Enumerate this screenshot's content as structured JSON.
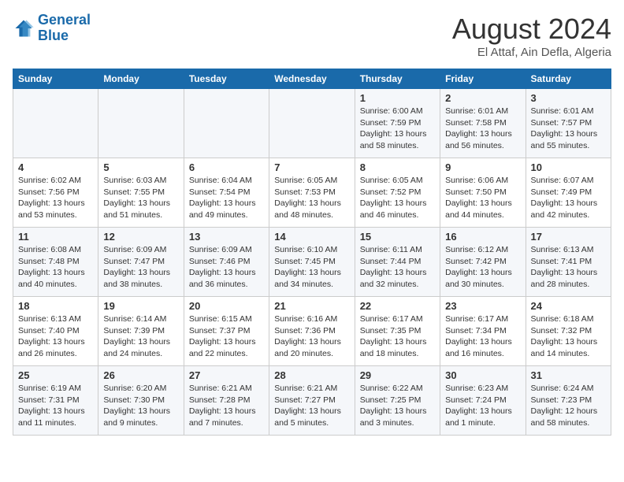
{
  "header": {
    "logo_line1": "General",
    "logo_line2": "Blue",
    "month": "August 2024",
    "location": "El Attaf, Ain Defla, Algeria"
  },
  "columns": [
    "Sunday",
    "Monday",
    "Tuesday",
    "Wednesday",
    "Thursday",
    "Friday",
    "Saturday"
  ],
  "weeks": [
    [
      {
        "day": "",
        "info": ""
      },
      {
        "day": "",
        "info": ""
      },
      {
        "day": "",
        "info": ""
      },
      {
        "day": "",
        "info": ""
      },
      {
        "day": "1",
        "info": "Sunrise: 6:00 AM\nSunset: 7:59 PM\nDaylight: 13 hours\nand 58 minutes."
      },
      {
        "day": "2",
        "info": "Sunrise: 6:01 AM\nSunset: 7:58 PM\nDaylight: 13 hours\nand 56 minutes."
      },
      {
        "day": "3",
        "info": "Sunrise: 6:01 AM\nSunset: 7:57 PM\nDaylight: 13 hours\nand 55 minutes."
      }
    ],
    [
      {
        "day": "4",
        "info": "Sunrise: 6:02 AM\nSunset: 7:56 PM\nDaylight: 13 hours\nand 53 minutes."
      },
      {
        "day": "5",
        "info": "Sunrise: 6:03 AM\nSunset: 7:55 PM\nDaylight: 13 hours\nand 51 minutes."
      },
      {
        "day": "6",
        "info": "Sunrise: 6:04 AM\nSunset: 7:54 PM\nDaylight: 13 hours\nand 49 minutes."
      },
      {
        "day": "7",
        "info": "Sunrise: 6:05 AM\nSunset: 7:53 PM\nDaylight: 13 hours\nand 48 minutes."
      },
      {
        "day": "8",
        "info": "Sunrise: 6:05 AM\nSunset: 7:52 PM\nDaylight: 13 hours\nand 46 minutes."
      },
      {
        "day": "9",
        "info": "Sunrise: 6:06 AM\nSunset: 7:50 PM\nDaylight: 13 hours\nand 44 minutes."
      },
      {
        "day": "10",
        "info": "Sunrise: 6:07 AM\nSunset: 7:49 PM\nDaylight: 13 hours\nand 42 minutes."
      }
    ],
    [
      {
        "day": "11",
        "info": "Sunrise: 6:08 AM\nSunset: 7:48 PM\nDaylight: 13 hours\nand 40 minutes."
      },
      {
        "day": "12",
        "info": "Sunrise: 6:09 AM\nSunset: 7:47 PM\nDaylight: 13 hours\nand 38 minutes."
      },
      {
        "day": "13",
        "info": "Sunrise: 6:09 AM\nSunset: 7:46 PM\nDaylight: 13 hours\nand 36 minutes."
      },
      {
        "day": "14",
        "info": "Sunrise: 6:10 AM\nSunset: 7:45 PM\nDaylight: 13 hours\nand 34 minutes."
      },
      {
        "day": "15",
        "info": "Sunrise: 6:11 AM\nSunset: 7:44 PM\nDaylight: 13 hours\nand 32 minutes."
      },
      {
        "day": "16",
        "info": "Sunrise: 6:12 AM\nSunset: 7:42 PM\nDaylight: 13 hours\nand 30 minutes."
      },
      {
        "day": "17",
        "info": "Sunrise: 6:13 AM\nSunset: 7:41 PM\nDaylight: 13 hours\nand 28 minutes."
      }
    ],
    [
      {
        "day": "18",
        "info": "Sunrise: 6:13 AM\nSunset: 7:40 PM\nDaylight: 13 hours\nand 26 minutes."
      },
      {
        "day": "19",
        "info": "Sunrise: 6:14 AM\nSunset: 7:39 PM\nDaylight: 13 hours\nand 24 minutes."
      },
      {
        "day": "20",
        "info": "Sunrise: 6:15 AM\nSunset: 7:37 PM\nDaylight: 13 hours\nand 22 minutes."
      },
      {
        "day": "21",
        "info": "Sunrise: 6:16 AM\nSunset: 7:36 PM\nDaylight: 13 hours\nand 20 minutes."
      },
      {
        "day": "22",
        "info": "Sunrise: 6:17 AM\nSunset: 7:35 PM\nDaylight: 13 hours\nand 18 minutes."
      },
      {
        "day": "23",
        "info": "Sunrise: 6:17 AM\nSunset: 7:34 PM\nDaylight: 13 hours\nand 16 minutes."
      },
      {
        "day": "24",
        "info": "Sunrise: 6:18 AM\nSunset: 7:32 PM\nDaylight: 13 hours\nand 14 minutes."
      }
    ],
    [
      {
        "day": "25",
        "info": "Sunrise: 6:19 AM\nSunset: 7:31 PM\nDaylight: 13 hours\nand 11 minutes."
      },
      {
        "day": "26",
        "info": "Sunrise: 6:20 AM\nSunset: 7:30 PM\nDaylight: 13 hours\nand 9 minutes."
      },
      {
        "day": "27",
        "info": "Sunrise: 6:21 AM\nSunset: 7:28 PM\nDaylight: 13 hours\nand 7 minutes."
      },
      {
        "day": "28",
        "info": "Sunrise: 6:21 AM\nSunset: 7:27 PM\nDaylight: 13 hours\nand 5 minutes."
      },
      {
        "day": "29",
        "info": "Sunrise: 6:22 AM\nSunset: 7:25 PM\nDaylight: 13 hours\nand 3 minutes."
      },
      {
        "day": "30",
        "info": "Sunrise: 6:23 AM\nSunset: 7:24 PM\nDaylight: 13 hours\nand 1 minute."
      },
      {
        "day": "31",
        "info": "Sunrise: 6:24 AM\nSunset: 7:23 PM\nDaylight: 12 hours\nand 58 minutes."
      }
    ]
  ]
}
